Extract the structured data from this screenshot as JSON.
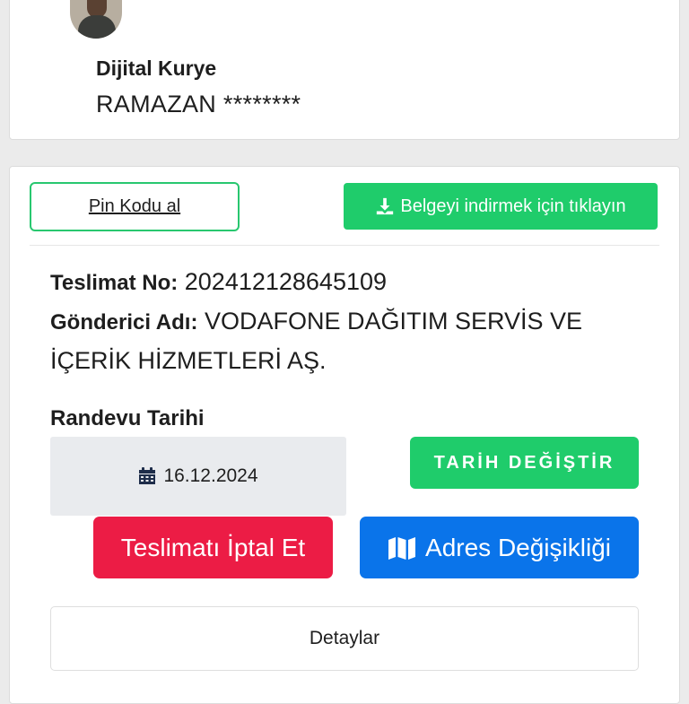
{
  "courier": {
    "label": "Dijital Kurye",
    "name": "RAMAZAN ********"
  },
  "actions": {
    "pin_label": "Pin Kodu al",
    "download_label": "Belgeyi indirmek için tıklayın"
  },
  "delivery": {
    "number_key": "Teslimat No",
    "number_value": "202412128645109",
    "sender_key": "Gönderici Adı",
    "sender_value_line1": "VODAFONE DAĞITIM SERVİS VE",
    "sender_value_line2": "İÇERİK HİZMETLERİ AŞ."
  },
  "appointment": {
    "label": "Randevu Tarihi",
    "date": "16.12.2024",
    "change_label": "TARİH DEĞİŞTİR"
  },
  "buttons": {
    "cancel_label": "Teslimatı İptal Et",
    "address_label": "Adres Değişikliği",
    "details_label": "Detaylar"
  },
  "colors": {
    "green": "#1fcc6b",
    "red": "#ec1c45",
    "blue": "#0a74ea"
  },
  "icons": {
    "download": "download-icon",
    "calendar": "calendar-icon",
    "map": "map-icon"
  }
}
